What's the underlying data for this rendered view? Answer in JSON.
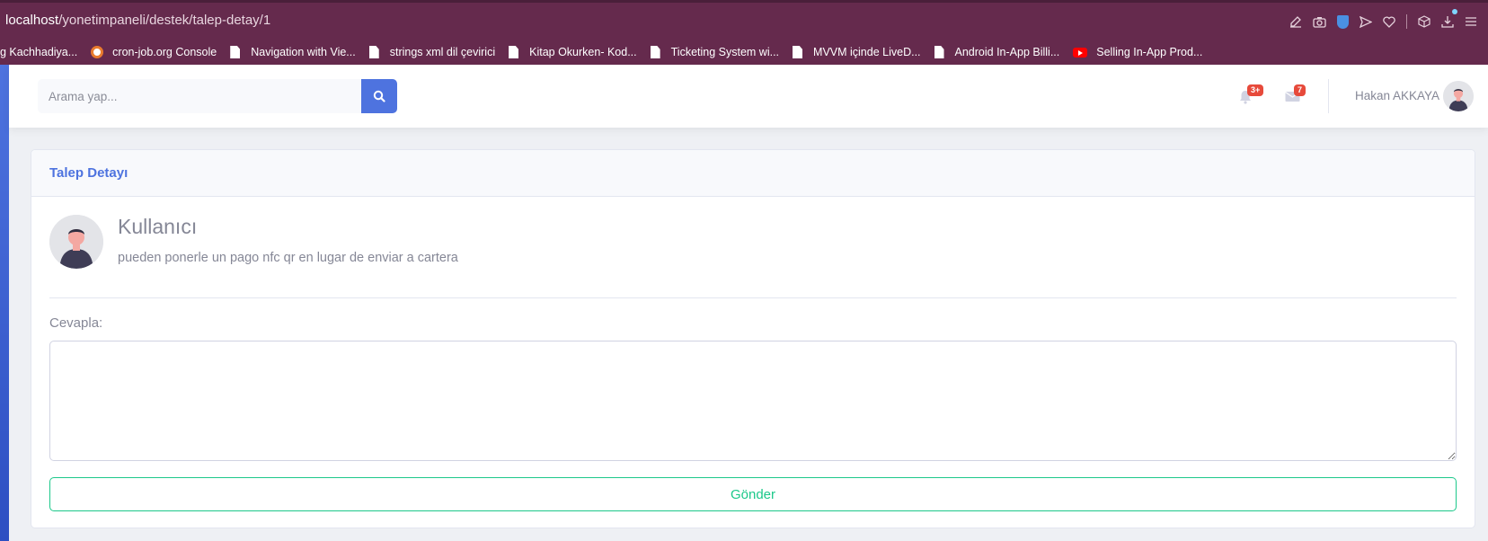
{
  "browser": {
    "url_host": "localhost",
    "url_path": "/yonetimpaneli/destek/talep-detay/1",
    "bookmarks": [
      {
        "label": "g Kachhadiya...",
        "icon": "none"
      },
      {
        "label": "cron-job.org Console",
        "icon": "cron-icon"
      },
      {
        "label": "Navigation with Vie...",
        "icon": "page-icon"
      },
      {
        "label": "strings xml dil çevirici",
        "icon": "page-icon"
      },
      {
        "label": "Kitap Okurken- Kod...",
        "icon": "page-icon"
      },
      {
        "label": "Ticketing System wi...",
        "icon": "page-icon"
      },
      {
        "label": "MVVM içinde LiveD...",
        "icon": "page-icon"
      },
      {
        "label": "Android In-App Billi...",
        "icon": "page-icon"
      },
      {
        "label": "Selling In-App Prod...",
        "icon": "youtube-icon"
      }
    ]
  },
  "topbar": {
    "search_placeholder": "Arama yap...",
    "notifications_badge": "3+",
    "messages_badge": "7",
    "user_name": "Hakan AKKAYA"
  },
  "card": {
    "title": "Talep Detayı",
    "message_user": "Kullanıcı",
    "message_text": "pueden ponerle un pago nfc qr en lugar de enviar a cartera",
    "reply_label": "Cevapla:",
    "send_label": "Gönder"
  },
  "colors": {
    "primary": "#4e73df",
    "success": "#1cc88a",
    "danger": "#e74a3b",
    "browser_bar": "#652a4d"
  }
}
